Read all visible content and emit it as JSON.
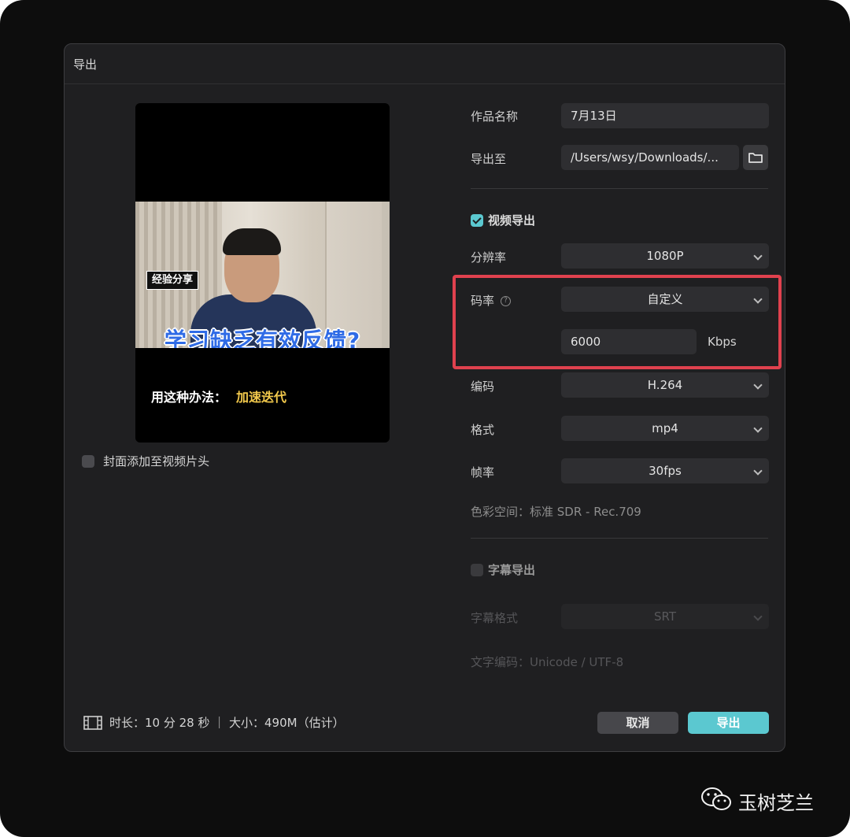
{
  "dialog": {
    "title": "导出"
  },
  "preview": {
    "tag": "经验分享",
    "headline": "学习缺乏有效反馈?",
    "tip_prefix": "用这种办法：",
    "tip_highlight": "加速迭代",
    "cover_option_label": "封面添加至视频片头",
    "cover_option_checked": false
  },
  "form": {
    "name_label": "作品名称",
    "name_value": "7月13日",
    "export_to_label": "导出至",
    "export_to_value": "/Users/wsy/Downloads/...",
    "video_export_label": "视频导出",
    "video_export_checked": true,
    "resolution_label": "分辨率",
    "resolution_value": "1080P",
    "bitrate_label": "码率",
    "bitrate_mode": "自定义",
    "bitrate_value": "6000",
    "bitrate_unit": "Kbps",
    "codec_label": "编码",
    "codec_value": "H.264",
    "format_label": "格式",
    "format_value": "mp4",
    "framerate_label": "帧率",
    "framerate_value": "30fps",
    "color_space": "色彩空间：标准 SDR - Rec.709",
    "subtitle_export_label": "字幕导出",
    "subtitle_export_checked": false,
    "subtitle_format_label": "字幕格式",
    "subtitle_format_value": "SRT",
    "text_encoding": "文字编码：Unicode / UTF-8"
  },
  "footer": {
    "info": "时长：10 分 28 秒 ｜ 大小：490M（估计）",
    "cancel_label": "取消",
    "export_label": "导出"
  },
  "watermark": {
    "text": "玉树芝兰"
  },
  "colors": {
    "accent": "#5bc8d0",
    "highlight_box": "#e0414e",
    "dialog_bg": "#1f1f21"
  }
}
